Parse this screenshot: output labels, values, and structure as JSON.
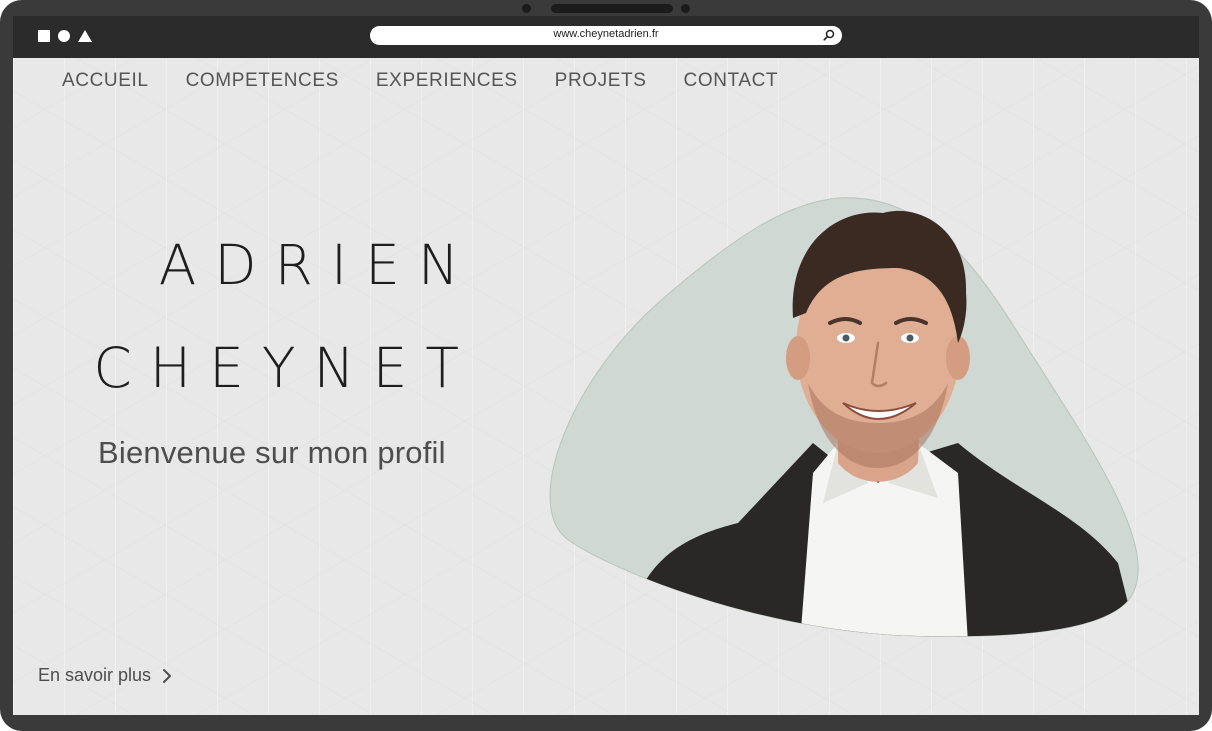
{
  "browser": {
    "url": "www.cheynetadrien.fr"
  },
  "nav": {
    "items": [
      {
        "label": "ACCUEIL"
      },
      {
        "label": "COMPETENCES"
      },
      {
        "label": "EXPERIENCES"
      },
      {
        "label": "PROJETS"
      },
      {
        "label": "CONTACT"
      }
    ]
  },
  "hero": {
    "first_name": "ADRIEN",
    "last_name": "CHEYNET",
    "welcome": "Bienvenue sur mon profil",
    "more_label": "En savoir plus"
  },
  "icons": {
    "window_controls": [
      "square-icon",
      "circle-icon",
      "triangle-icon"
    ],
    "search": "search-icon",
    "more": "chevron-right-icon"
  },
  "colors": {
    "frame": "#3a3a3a",
    "topbar": "#2b2b2b",
    "page_background": "#e8e8e8",
    "portrait_background": "#cfd8d2",
    "text_dark": "#1e1e1e",
    "text_muted": "#555555"
  }
}
